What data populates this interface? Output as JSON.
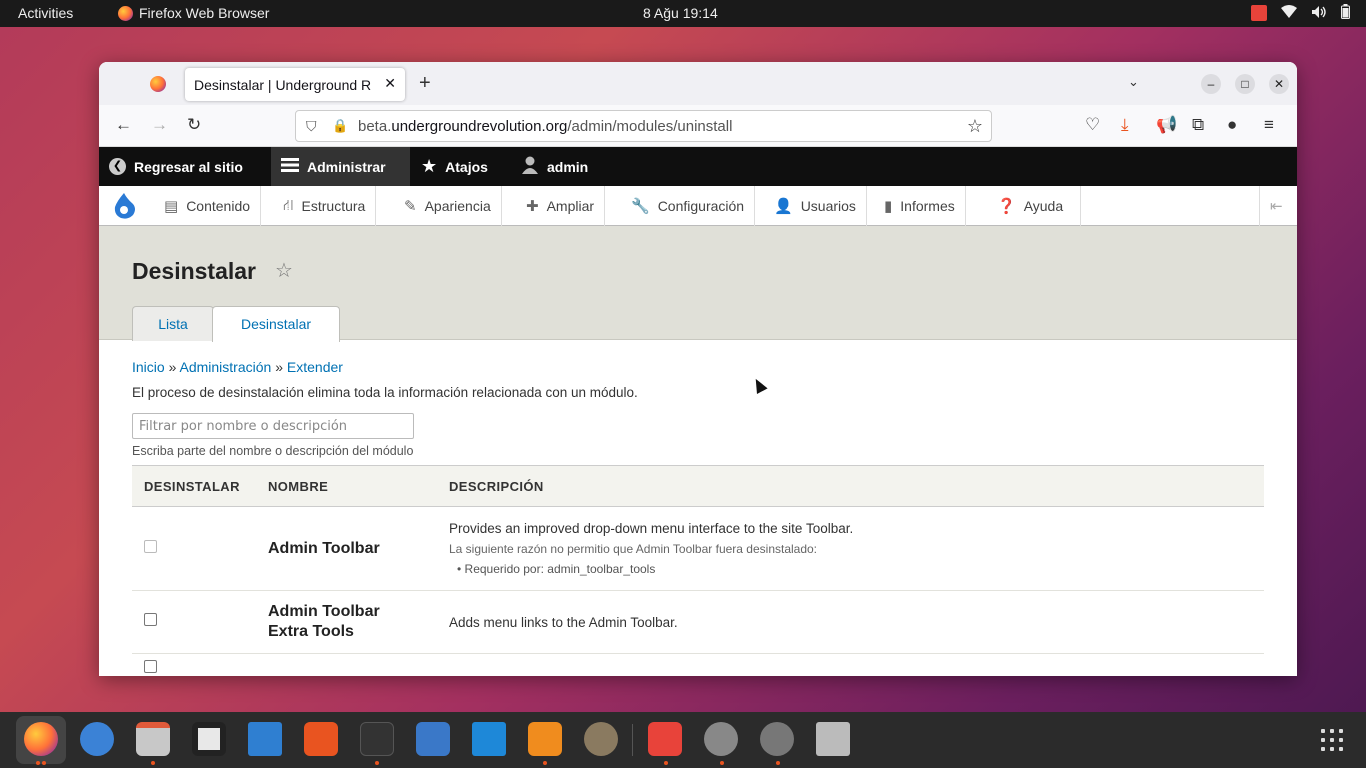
{
  "topbar": {
    "activities": "Activities",
    "app_name": "Firefox Web Browser",
    "clock": "8 Ağu  19:14"
  },
  "browser": {
    "tab_title": "Desinstalar | Underground R",
    "url_prefix": "beta.",
    "url_domain": "undergroundrevolution.org",
    "url_path": "/admin/modules/uninstall"
  },
  "toolbar": {
    "back_to_site": "Regresar al sitio",
    "manage": "Administrar",
    "shortcuts": "Atajos",
    "user": "admin"
  },
  "admin_menu": {
    "items": [
      "Contenido",
      "Estructura",
      "Apariencia",
      "Ampliar",
      "Configuración",
      "Usuarios",
      "Informes",
      "Ayuda"
    ]
  },
  "page": {
    "title": "Desinstalar",
    "tabs": [
      "Lista",
      "Desinstalar"
    ],
    "breadcrumb": [
      "Inicio",
      "Administración",
      "Extender"
    ],
    "breadcrumb_sep": "»",
    "intro": "El proceso de desinstalación elimina toda la información relacionada con un módulo.",
    "filter_placeholder": "Filtrar por nombre o descripción",
    "filter_help": "Escriba parte del nombre o descripción del módulo"
  },
  "table": {
    "headers": [
      "DESINSTALAR",
      "NOMBRE",
      "DESCRIPCIÓN"
    ],
    "rows": [
      {
        "name": "Admin Toolbar",
        "description": "Provides an improved drop-down menu interface to the site Toolbar.",
        "reason": "La siguiente razón no permitio que Admin Toolbar fuera desinstalado:",
        "required_by": "Requerido por: admin_toolbar_tools",
        "disabled": true
      },
      {
        "name_line1": "Admin Toolbar",
        "name_line2": "Extra Tools",
        "description": "Adds menu links to the Admin Toolbar.",
        "disabled": false
      }
    ]
  },
  "colors": {
    "link": "#0071b3",
    "toolbar_bg": "#0f0f0f",
    "header_bg": "#e0e0d8"
  }
}
